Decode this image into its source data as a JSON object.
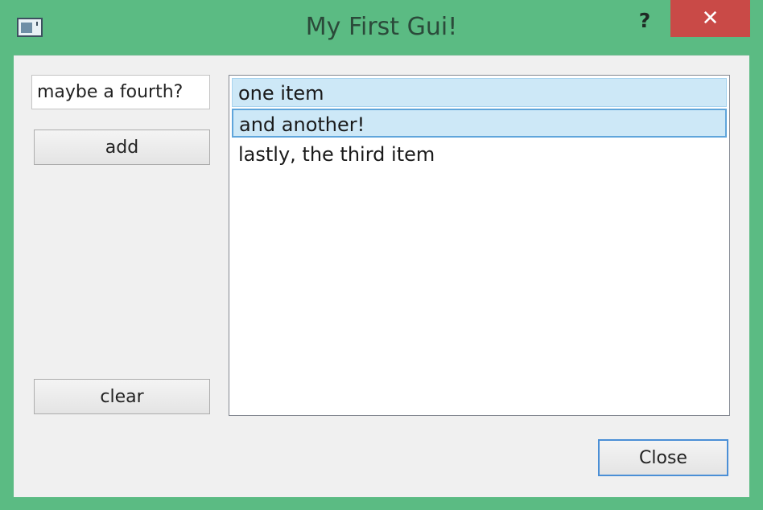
{
  "window": {
    "title": "My First Gui!",
    "help_label": "?",
    "close_label": "✕"
  },
  "left_panel": {
    "input_value": "maybe a fourth?",
    "add_label": "add",
    "clear_label": "clear"
  },
  "list": {
    "items": [
      {
        "label": "one item",
        "state": "selected"
      },
      {
        "label": "and another!",
        "state": "current"
      },
      {
        "label": "lastly, the third item",
        "state": "normal"
      }
    ]
  },
  "footer": {
    "close_button_label": "Close"
  },
  "colors": {
    "titlebar": "#5bbb83",
    "close_button": "#c94a47",
    "selection": "#cde8f7",
    "focus_border": "#4b8fd6"
  }
}
